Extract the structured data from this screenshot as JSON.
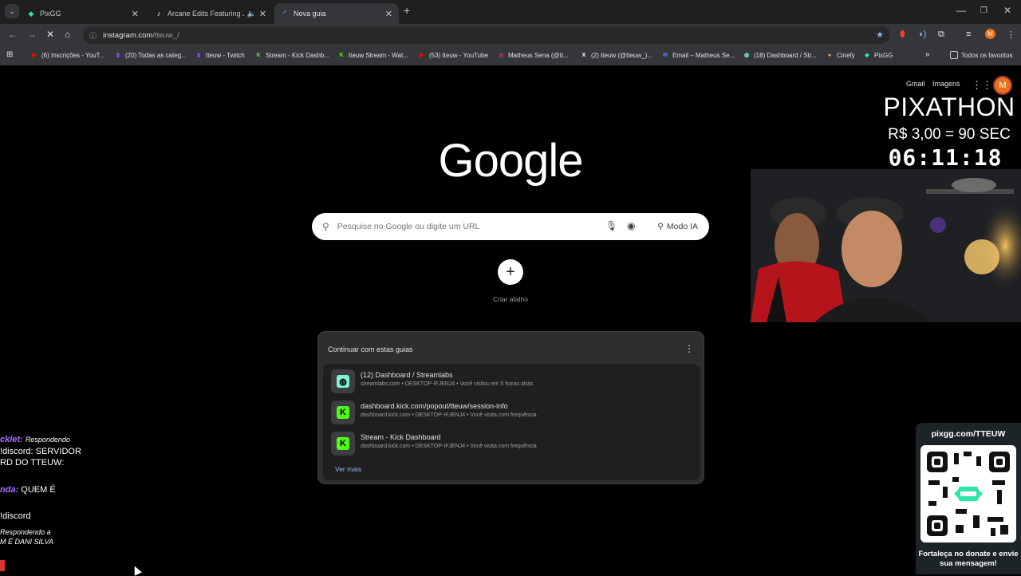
{
  "browser": {
    "tabs": [
      {
        "title": "PixGG",
        "favicon": "pixgg-icon",
        "active": false
      },
      {
        "title": "Arcane Edits Featuring Jinx",
        "favicon": "tiktok-icon",
        "active": false
      },
      {
        "title": "Nova guia",
        "favicon": "loading-icon",
        "active": true
      }
    ],
    "address": {
      "host": "instagram.com",
      "path": "/tteuw_/"
    },
    "bookmarks": [
      {
        "label": "(6) Inscrições - YouT...",
        "color": "#ff0000",
        "icon": "youtube-icon"
      },
      {
        "label": "(20) Todas as categ...",
        "color": "#9146ff",
        "icon": "twitch-icon"
      },
      {
        "label": "tteuw - Twitch",
        "color": "#9146ff",
        "icon": "twitch-icon"
      },
      {
        "label": "Stream - Kick Dashb...",
        "color": "#53fc18",
        "icon": "kick-icon"
      },
      {
        "label": "tteuw Stream - Wat...",
        "color": "#53fc18",
        "icon": "kick-icon"
      },
      {
        "label": "(53) tteuw - YouTube",
        "color": "#ff0000",
        "icon": "youtube-icon"
      },
      {
        "label": "Matheus Sena (@tt...",
        "color": "#e1306c",
        "icon": "instagram-icon"
      },
      {
        "label": "(2) tteuw (@tteuw_)...",
        "color": "#ffffff",
        "icon": "x-icon"
      },
      {
        "label": "Email – Matheus Se...",
        "color": "#4285f4",
        "icon": "outlook-icon"
      },
      {
        "label": "(18) Dashboard / Str...",
        "color": "#80f5d2",
        "icon": "streamlabs-icon"
      },
      {
        "label": "Cinefy",
        "color": "#fbbc04",
        "icon": "cinefy-icon"
      },
      {
        "label": "PixGG",
        "color": "#2ee6a6",
        "icon": "pixgg-icon"
      }
    ],
    "all_bookmarks": "Todos os favoritos"
  },
  "google": {
    "gmail": "Gmail",
    "images": "Imagens",
    "avatar_letter": "M",
    "logo": "Google",
    "search_placeholder": "Pesquise no Google ou digite um URL",
    "ai_mode": "Modo IA",
    "shortcut_label": "Criar atalho",
    "continue_title": "Continuar com estas guias",
    "see_more": "Ver mais",
    "continue_items": [
      {
        "title": "(12) Dashboard / Streamlabs",
        "subtitle": "streamlabs.com • DESKTOP-IFJENJ4 • Você visitou em 5 horas atrás",
        "icon": "streamlabs-icon",
        "color": "#80f5d2"
      },
      {
        "title": "dashboard.kick.com/popout/tteuw/session-info",
        "subtitle": "dashboard.kick.com • DESKTOP-IFJENJ4 • Você visita com frequência",
        "icon": "kick-icon",
        "color": "#53fc18"
      },
      {
        "title": "Stream - Kick Dashboard",
        "subtitle": "dashboard.kick.com • DESKTOP-IFJENJ4 • Você visita com frequência",
        "icon": "kick-icon",
        "color": "#53fc18"
      }
    ]
  },
  "overlay": {
    "pixathon": "PIXATHON",
    "price": "R$ 3,00 = 90 SEC",
    "timer": "06:11:18",
    "pixgg_url": "pixgg.com/TTEUW",
    "pixgg_message": "Fortaleça no donate e envie sua mensagem!"
  },
  "chat": [
    {
      "user": "cklet:",
      "text": "Respondendo",
      "reply": true
    },
    {
      "user": "",
      "text": "!discord: SERVIDOR",
      "reply": false
    },
    {
      "user": "",
      "text": "RD DO TTEUW:",
      "reply": false
    },
    {
      "user": "nda:",
      "text": "QUEM É",
      "reply": false
    },
    {
      "user": "",
      "text": "!discord",
      "reply": false
    },
    {
      "user": "",
      "text": "Respondendo a",
      "reply": true
    },
    {
      "user": "",
      "text": "M É DANI SILVA",
      "reply": true
    }
  ]
}
